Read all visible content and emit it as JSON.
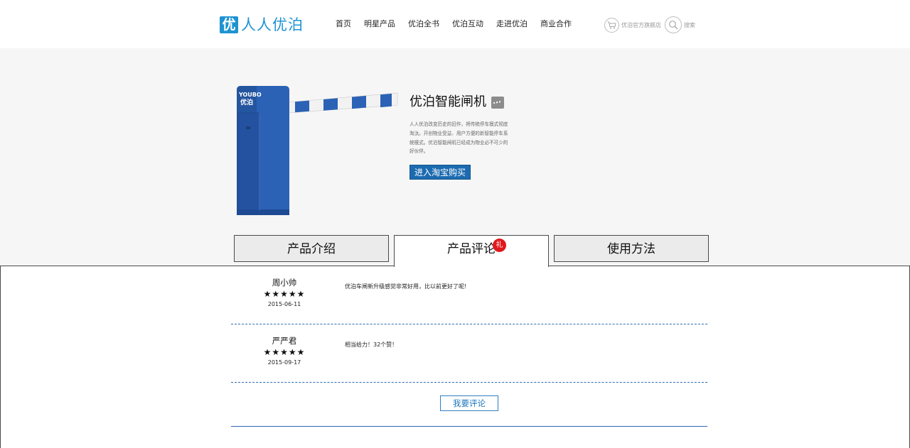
{
  "header": {
    "logo_mark": "优",
    "logo_text": "人人优泊",
    "nav": [
      "首页",
      "明星产品",
      "优泊全书",
      "优泊互动",
      "走进优泊",
      "商业合作"
    ],
    "store_label": "优泊官方旗舰店",
    "search_label": "搜索"
  },
  "product": {
    "brand_mark": "YOUBO",
    "brand_mark_cn": "优泊",
    "title": "优泊智能闸机",
    "description": "人人优泊改变历史的旧作，将传统停车模式彻底淘汰。开创物业受益、用户方便的新智能停车系统模式。优泊智能闸机已经成为物业必不可少的好伙伴。",
    "buy_label": "进入淘宝购买"
  },
  "tabs": {
    "intro": "产品介绍",
    "review": "产品评论",
    "review_badge": "礼",
    "usage": "使用方法"
  },
  "reviews": [
    {
      "name": "周小帅",
      "stars": "★★★★★",
      "date": "2015-06-11",
      "text": "优泊车闸新升级感觉非常好用，比以前更好了呢!"
    },
    {
      "name": "严严君",
      "stars": "★★★★★",
      "date": "2015-09-17",
      "text": "相当给力！32个赞！"
    }
  ],
  "comment_button": "我要评论",
  "colors": {
    "brand_blue": "#1d93d2",
    "button_blue": "#1c6bb0",
    "badge_red": "#e0191d",
    "hero_bg": "#f6f6f6",
    "product_blue": "#2b62b6"
  }
}
